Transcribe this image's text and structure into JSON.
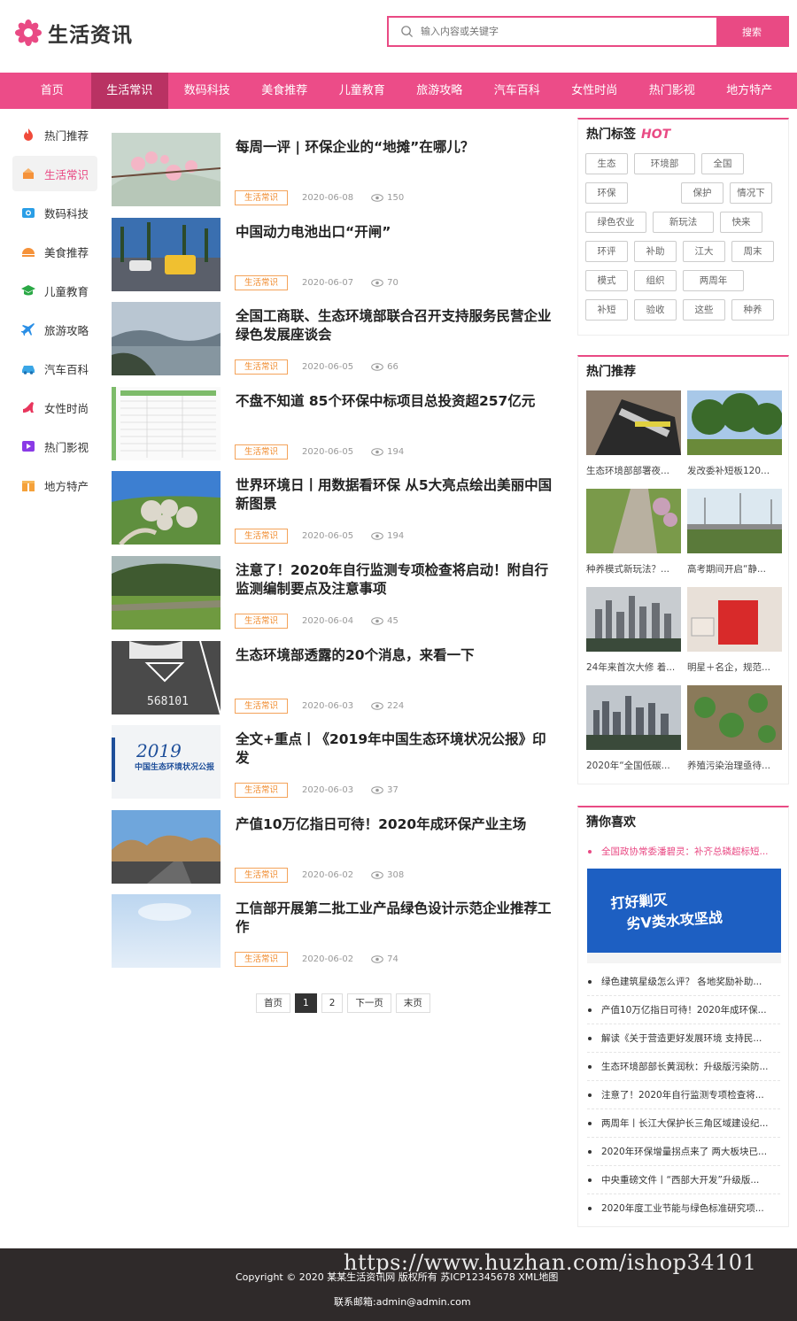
{
  "brand": {
    "name": "生活资讯",
    "accent": "#e94a84"
  },
  "search": {
    "placeholder": "输入内容或关键字",
    "button": "搜索"
  },
  "nav": [
    "首页",
    "生活常识",
    "数码科技",
    "美食推荐",
    "儿童教育",
    "旅游攻略",
    "汽车百科",
    "女性时尚",
    "热门影视",
    "地方特产"
  ],
  "sidebar": [
    {
      "label": "热门推荐",
      "icon": "fire-icon"
    },
    {
      "label": "生活常识",
      "icon": "cake-icon"
    },
    {
      "label": "数码科技",
      "icon": "camera-icon"
    },
    {
      "label": "美食推荐",
      "icon": "food-icon"
    },
    {
      "label": "儿童教育",
      "icon": "graduation-icon"
    },
    {
      "label": "旅游攻略",
      "icon": "plane-icon"
    },
    {
      "label": "汽车百科",
      "icon": "car-icon"
    },
    {
      "label": "女性时尚",
      "icon": "heel-icon"
    },
    {
      "label": "热门影视",
      "icon": "play-icon"
    },
    {
      "label": "地方特产",
      "icon": "gift-icon"
    }
  ],
  "articles": [
    {
      "title": "每周一评 | 环保企业的“地摊”在哪儿？",
      "tag": "生活常识",
      "date": "2020-06-08",
      "views": "150"
    },
    {
      "title": "中国动力电池出口“开闸”",
      "tag": "生活常识",
      "date": "2020-06-07",
      "views": "70"
    },
    {
      "title": "全国工商联、生态环境部联合召开支持服务民营企业绿色发展座谈会",
      "tag": "生活常识",
      "date": "2020-06-05",
      "views": "66"
    },
    {
      "title": "不盘不知道 85个环保中标项目总投资超257亿元",
      "tag": "生活常识",
      "date": "2020-06-05",
      "views": "194"
    },
    {
      "title": "世界环境日丨用数据看环保 从5大亮点绘出美丽中国新图景",
      "tag": "生活常识",
      "date": "2020-06-05",
      "views": "194"
    },
    {
      "title": "注意了！2020年自行监测专项检查将启动！附自行监测编制要点及注意事项",
      "tag": "生活常识",
      "date": "2020-06-04",
      "views": "45"
    },
    {
      "title": "生态环境部透露的20个消息，来看一下",
      "tag": "生活常识",
      "date": "2020-06-03",
      "views": "224"
    },
    {
      "title": "全文+重点丨《2019年中国生态环境状况公报》印发",
      "tag": "生活常识",
      "date": "2020-06-03",
      "views": "37"
    },
    {
      "title": "产值10万亿指日可待！2020年成环保产业主场",
      "tag": "生活常识",
      "date": "2020-06-02",
      "views": "308"
    },
    {
      "title": "工信部开展第二批工业产品绿色设计示范企业推荐工作",
      "tag": "生活常识",
      "date": "2020-06-02",
      "views": "74"
    }
  ],
  "pager": {
    "first": "首页",
    "p1": "1",
    "p2": "2",
    "next": "下一页",
    "last": "末页"
  },
  "thumb_texts": {
    "plate": "568101",
    "report_year": "2019",
    "report_title": "中国生态环境状况公报"
  },
  "hot_tags": {
    "title": "热门标签",
    "badge": "HOT",
    "tags": [
      "生态",
      "环境部",
      "全国",
      "环保",
      "保护",
      "情况下",
      "绿色农业",
      "新玩法",
      "快来",
      "环评",
      "补助",
      "江大",
      "周末",
      "模式",
      "组织",
      "两周年",
      "补短",
      "验收",
      "这些",
      "种养"
    ]
  },
  "hot_recommend": {
    "title": "热门推荐",
    "items": [
      "生态环境部部署夜...",
      "发改委补短板120...",
      "种养模式新玩法？...",
      "高考期间开启“静...",
      "24年来首次大修 着...",
      "明星＋名企，规范...",
      "2020年“全国低碳...",
      "养殖污染治理亟待..."
    ]
  },
  "guess": {
    "title": "猜你喜欢",
    "first": "全国政协常委潘碧灵：补齐总磷超标短...",
    "banner_line1": "打好剿灭",
    "banner_line2": "劣Ⅴ类水攻坚战",
    "items": [
      "绿色建筑星级怎么评？ 各地奖励补助...",
      "产值10万亿指日可待！2020年成环保...",
      "解读《关于营造更好发展环境 支持民...",
      "生态环境部部长黄润秋：升级版污染防...",
      "注意了！2020年自行监测专项检查将...",
      "两周年丨长江大保护长三角区域建设纪...",
      "2020年环保增量拐点来了 两大板块已...",
      "中央重磅文件丨“西部大开发”升级版...",
      "2020年度工业节能与绿色标准研究项..."
    ]
  },
  "footer": {
    "copyright": "Copyright © 2020 某某生活资讯网 版权所有   苏ICP12345678   XML地图",
    "email": "联系邮箱:admin@admin.com",
    "watermark": "https://www.huzhan.com/ishop34101"
  }
}
